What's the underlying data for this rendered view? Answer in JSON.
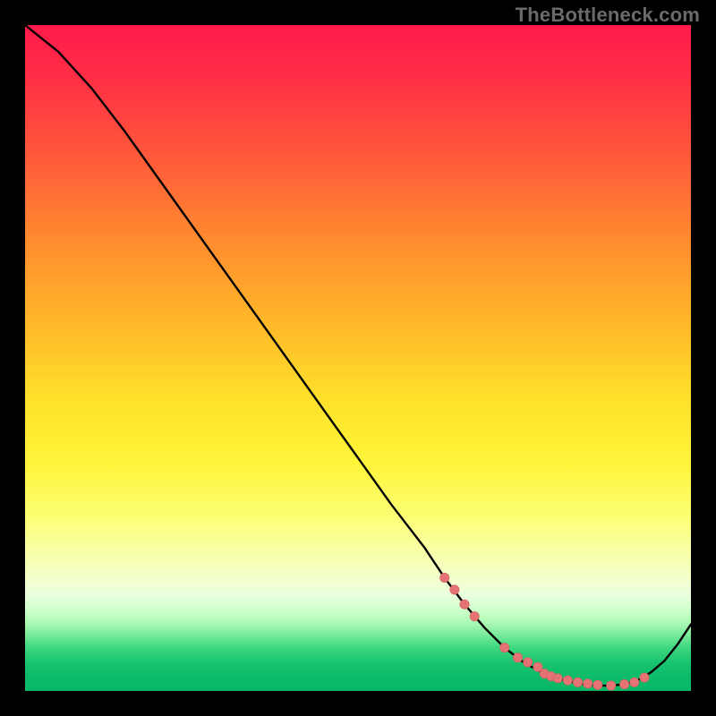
{
  "watermark": "TheBottleneck.com",
  "chart_data": {
    "type": "line",
    "title": "",
    "xlabel": "",
    "ylabel": "",
    "xlim": [
      0,
      100
    ],
    "ylim": [
      0,
      100
    ],
    "series": [
      {
        "name": "curve",
        "x": [
          0,
          5,
          10,
          15,
          20,
          25,
          30,
          35,
          40,
          45,
          50,
          55,
          60,
          63,
          66,
          69,
          72,
          75,
          78,
          81,
          84,
          86,
          88,
          90,
          92,
          94,
          96,
          98,
          100
        ],
        "y": [
          100,
          96,
          90.5,
          84,
          77,
          70,
          63,
          56,
          49,
          42,
          35,
          28,
          21.5,
          17,
          13,
          9.5,
          6.5,
          4.2,
          2.6,
          1.6,
          1.0,
          0.8,
          0.8,
          1.0,
          1.6,
          2.8,
          4.5,
          7.0,
          10.0
        ]
      }
    ],
    "points": {
      "name": "markers",
      "x": [
        63,
        64.5,
        66,
        67.5,
        72,
        74,
        75.5,
        77,
        78,
        79,
        80,
        81.5,
        83,
        84.5,
        86,
        88,
        90,
        91.5,
        93
      ],
      "y": [
        17,
        15.2,
        13,
        11.2,
        6.5,
        5.0,
        4.3,
        3.6,
        2.6,
        2.2,
        1.9,
        1.6,
        1.3,
        1.1,
        0.9,
        0.8,
        1.0,
        1.3,
        2.0
      ]
    },
    "colors": {
      "curve": "#000000",
      "markers": "#e57373",
      "gradient_top": "#ff1a4b",
      "gradient_mid": "#ffe02a",
      "gradient_bottom": "#07b866"
    }
  }
}
